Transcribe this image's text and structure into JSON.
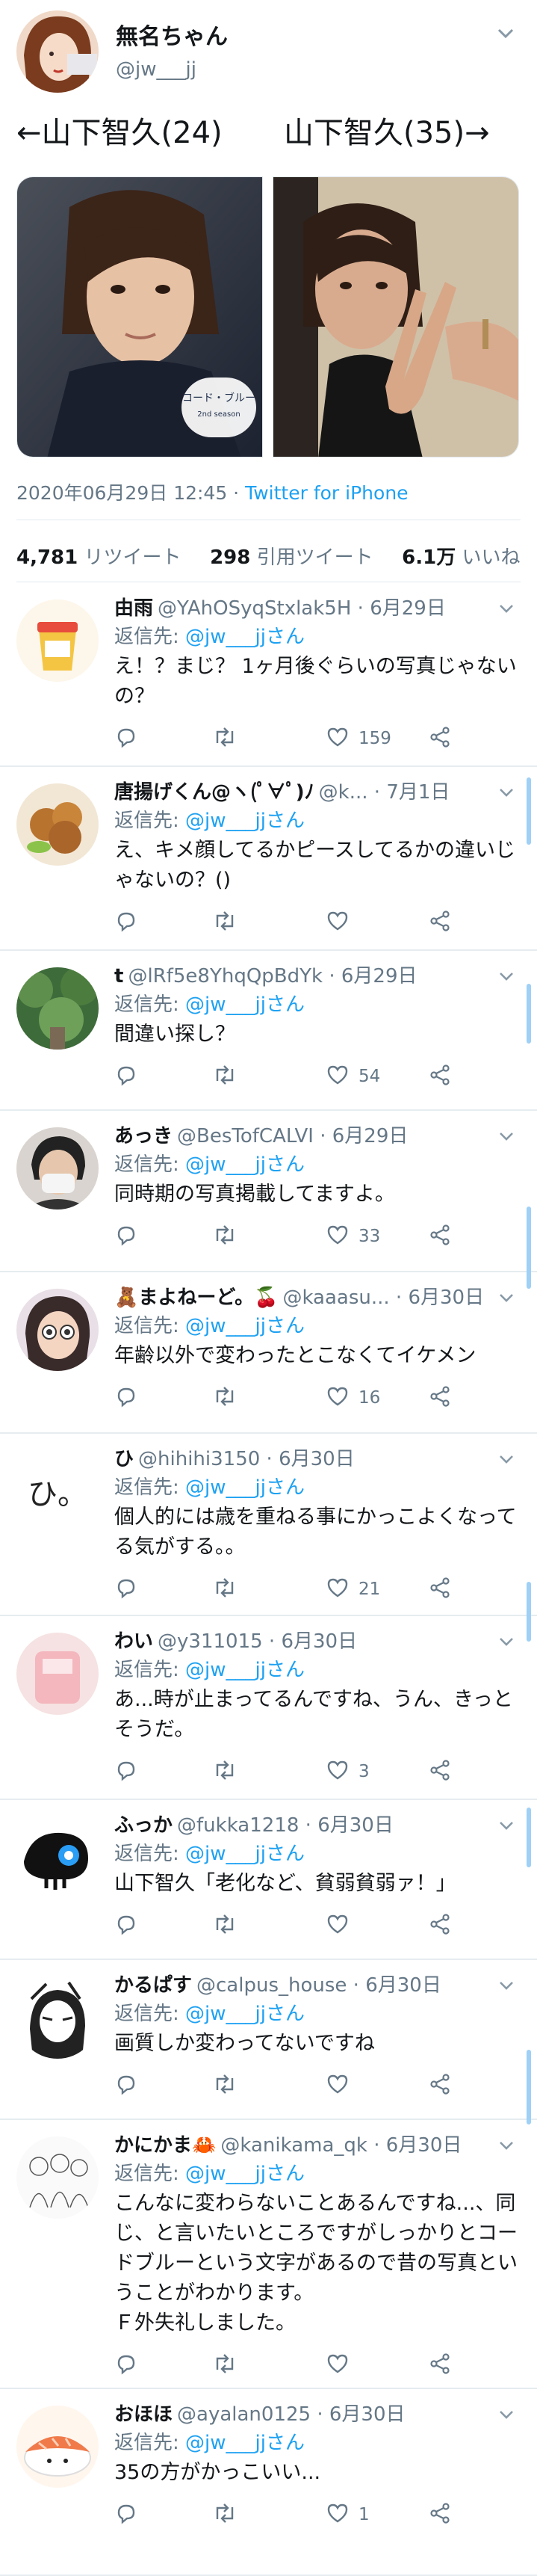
{
  "main_tweet": {
    "author_name": "無名ちゃん",
    "author_handle": "@jw___jj",
    "text_left": "←山下智久(24)",
    "text_right": "山下智久(35)→",
    "date": "2020年06月29日 12:45 · ",
    "source": "Twitter for iPhone",
    "retweets": "4,781",
    "retweets_label": "リツイート",
    "quotes": "298",
    "quotes_label": "引用ツイート",
    "likes": "6.1万",
    "likes_label": "いいね"
  },
  "reply_to_label": "返信先: ",
  "reply_to_link": "@jw___jjさん",
  "replies": [
    {
      "name": "由雨",
      "handle": "@YAhOSyqStxlak5H · 6月29日",
      "text": "え！？まじ？ 1ヶ月後ぐらいの写真じゃないの？",
      "likes": "159",
      "avatar": "noodle"
    },
    {
      "name": "唐揚げくん@ヽ(ﾟ∀ﾟ)ﾉ",
      "handle": "@k... · 7月1日",
      "text": "え、キメ顔してるかピースしてるかの違いじゃないの？()",
      "likes": "",
      "avatar": "karaage"
    },
    {
      "name": "t",
      "handle": "@lRf5e8YhqQpBdYk · 6月29日",
      "text": "間違い探し？",
      "likes": "54",
      "avatar": "forest"
    },
    {
      "name": "あっき",
      "handle": "@BesTofCALVI · 6月29日",
      "text": "同時期の写真掲載してますよ。",
      "likes": "33",
      "avatar": "person"
    },
    {
      "name": "🧸まよねーど。🍒",
      "handle": "@kaaasu... · 6月30日",
      "text": "年齢以外で変わったとこなくてイケメン",
      "likes": "16",
      "avatar": "girl"
    },
    {
      "name": "ひ",
      "handle": "@hihihi3150 · 6月30日",
      "text": "個人的には歳を重ねる事にかっこよくなってる気がする。。",
      "likes": "21",
      "avatar": "hi"
    },
    {
      "name": "わい",
      "handle": "@y311015 · 6月30日",
      "text": "あ...時が止まってるんですね、うん、きっとそうだ。",
      "likes": "3",
      "avatar": "pink"
    },
    {
      "name": "ふっか",
      "handle": "@fukka1218 · 6月30日",
      "text": "山下智久「老化など、貧弱貧弱ァ！」",
      "likes": "",
      "avatar": "skull"
    },
    {
      "name": "かるぱす",
      "handle": "@calpus_house · 6月30日",
      "text": "画質しか変わってないですね",
      "likes": "",
      "avatar": "manga"
    },
    {
      "name": "かにかま🦀",
      "handle": "@kanikama_qk · 6月30日",
      "text": "こんなに変わらないことあるんですね...、同じ、と言いたいところですがしっかりとコードブルーという文字があるので昔の写真ということがわかります。\nＦ外失礼しました。",
      "likes": "",
      "avatar": "sketch"
    },
    {
      "name": "おほほ",
      "handle": "@ayalan0125 · 6月30日",
      "text": "35の方がかっこいい...",
      "likes": "1",
      "avatar": "sushi"
    }
  ]
}
